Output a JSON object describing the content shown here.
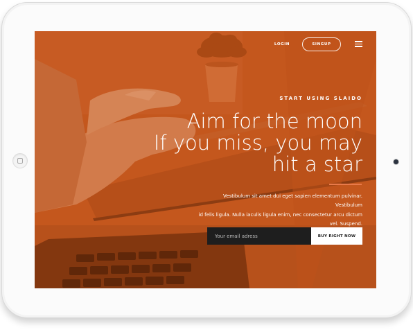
{
  "nav": {
    "login_label": "LOGIN",
    "signup_label": "SINGUP",
    "menu_icon": "hamburger-menu-icon"
  },
  "hero": {
    "eyebrow": "START USING SLAIDO",
    "headline_lines": [
      "Aim for the moon",
      "If you miss, you may",
      "hit a star"
    ],
    "body_lines": [
      "Vestibulum sit amet dui eget sapien elementum pulvinar. Vestibulum",
      "id felis ligula. Nulla iaculis ligula enim, nec consectetur arcu dictum",
      "vel. Suspend."
    ]
  },
  "form": {
    "email_placeholder": "Your email adress",
    "email_value": "",
    "cta_label": "BUY RIGHT NOW"
  },
  "colors": {
    "brand_orange": "#c4561c",
    "accent_divider": "#e87a4a",
    "input_dark": "#1e1e1e"
  },
  "device": {
    "home_button_icon": "home-button-icon",
    "camera_icon": "camera-icon"
  }
}
